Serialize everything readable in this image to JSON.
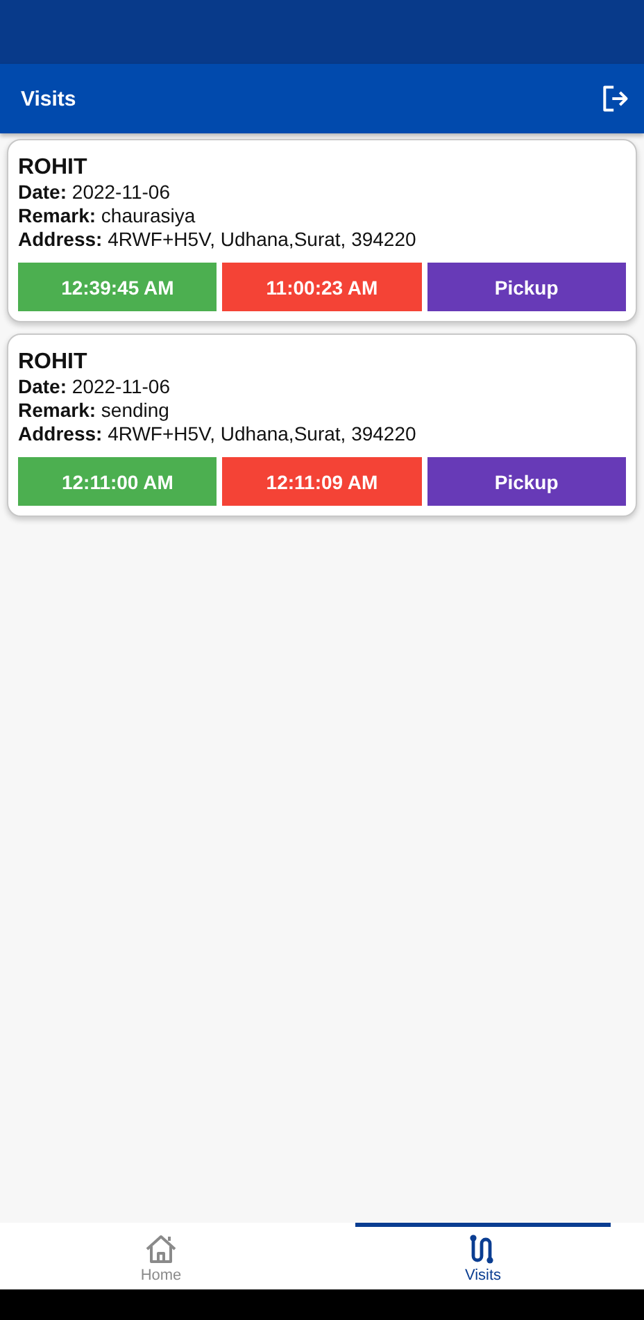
{
  "header": {
    "title": "Visits"
  },
  "visits": [
    {
      "name": "ROHIT",
      "lines": [
        "**Date:** 2022-11-06",
        "**Remark:** chaurasiya",
        "**Address:** 4RWF+H5V, Udhana,Surat, 394220"
      ],
      "buttons": [
        {
          "label": "12:39:45 AM",
          "color": "#4caf50"
        },
        {
          "label": "11:00:23 AM",
          "color": "#f44336"
        },
        {
          "label": "Pickup",
          "color": "#673ab7"
        }
      ]
    },
    {
      "name": "ROHIT",
      "lines": [
        "**Date:** 2022-11-06",
        "**Remark:** sending",
        "**Address:** 4RWF+H5V, Udhana,Surat, 394220"
      ],
      "buttons": [
        {
          "label": "12:11:00 AM",
          "color": "#4caf50"
        },
        {
          "label": "12:11:09 AM",
          "color": "#f44336"
        },
        {
          "label": "Pickup",
          "color": "#673ab7"
        }
      ]
    }
  ],
  "tabs": [
    {
      "label": "Home",
      "kind": "home",
      "selected": false
    },
    {
      "label": "Visits",
      "kind": "route",
      "selected": true
    }
  ]
}
